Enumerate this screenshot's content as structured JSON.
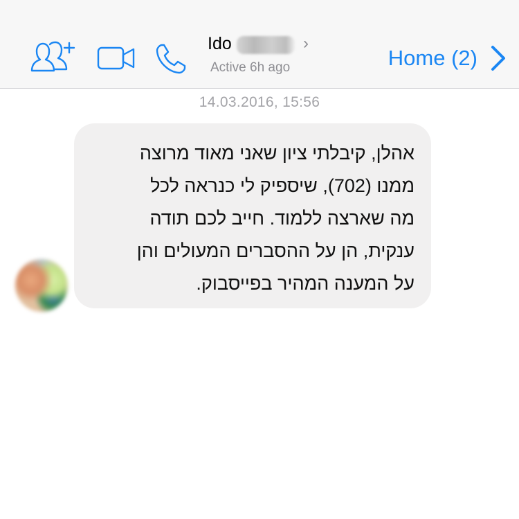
{
  "header": {
    "contact": {
      "name": "Ido",
      "status": "Active 6h ago",
      "chevron": "›"
    },
    "back": {
      "label": "Home (2)"
    },
    "icons": [
      "add-people-icon",
      "video-camera-icon",
      "phone-icon",
      "chevron-right-icon"
    ],
    "accent_color": "#1a86f3"
  },
  "conversation": {
    "timestamp": "14.03.2016, 15:56",
    "messages": [
      {
        "direction": "incoming",
        "bubble_color": "#f1f0f0",
        "lines": [
          "אהלן, קיבלתי ציון שאני מאוד מרוצה",
          "ממנו (702), שיספיק לי כנראה לכל",
          "מה שארצה ללמוד. חייב לכם תודה",
          "ענקית, הן על ההסברים המעולים והן",
          "על המענה המהיר בפייסבוק."
        ]
      }
    ]
  }
}
